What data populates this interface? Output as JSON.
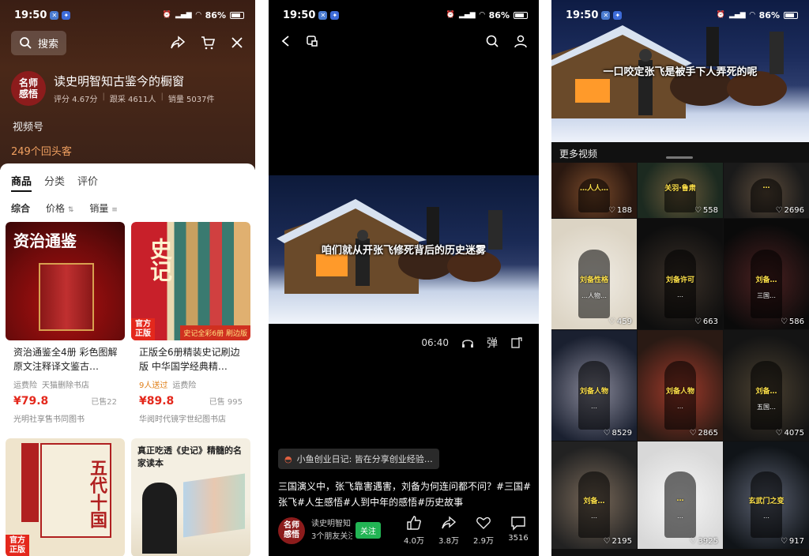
{
  "status": {
    "time": "19:50",
    "battery": "86%",
    "net_top": "427",
    "net_bottom": "B/s"
  },
  "shop_panel": {
    "search_label": "搜索",
    "shop_logo": "名师\n感悟",
    "shop_name": "读史明智知古鉴今的橱窗",
    "rating": "评分 4.67分",
    "reviews": "跟采 4611人",
    "sales": "销量 5037件",
    "channel": "视频号",
    "repeat_customers": "249个回头客",
    "tabs": [
      "商品",
      "分类",
      "评价"
    ],
    "sorts": [
      "综合",
      "价格",
      "销量"
    ],
    "products": [
      {
        "title": "资治通鉴全4册 彩色图解原文注释译文鉴古…",
        "tag1": "运费险",
        "tag2": "天猫删除书店",
        "price": "¥79.8",
        "sold": "已售22",
        "store": "光明社享售书同图书",
        "cover_text": "资治通鉴",
        "badge": ""
      },
      {
        "title": "正版全6册精装史记刷边版 中华国学经典精…",
        "tag1": "9人送过",
        "tag2": "运费险",
        "price": "¥89.8",
        "sold": "已售 995",
        "store": "华阅时代镜字世纪图书店",
        "cover_text": "史记",
        "badge": "官方\n正版",
        "promo": "史记全彩6册 刷边版"
      },
      {
        "title": "",
        "cover_text": "五代十国",
        "badge": "官方\n正版"
      },
      {
        "title": "",
        "cover_text": "真正吃透《史记》精髓的名家读本"
      }
    ]
  },
  "video_panel": {
    "subtitle": "咱们就从开张飞修死背后的历史迷雾",
    "duration": "06:40",
    "danmaku_label": "弹",
    "promo": "小鱼创业日记: 皆在分享创业经验…",
    "description": "三国演义中，张飞靠害遇害，刘备为何连问都不问？#三国#张飞#人生感悟#人到中年的感悟#历史故事",
    "author_logo": "名师\n感悟",
    "author_name": "读史明智知",
    "author_sub": "3个朋友关注",
    "follow_label": "关注",
    "likes": "4.0万",
    "shares": "3.8万",
    "favorites": "2.9万",
    "comments": "3516"
  },
  "more_panel": {
    "top_subtitle": "一口咬定张飞是被手下人弄死的呢",
    "more_label": "更多视频",
    "videos": [
      {
        "cap": "…人人…",
        "count": "188"
      },
      {
        "cap": "关羽·鲁肃",
        "count": "558"
      },
      {
        "cap": "…",
        "count": "2696"
      },
      {
        "cap": "刘备性格",
        "sub": "…人物…",
        "count": "459"
      },
      {
        "cap": "刘备许可",
        "sub": "…",
        "count": "663"
      },
      {
        "cap": "刘备…",
        "sub": "三国…",
        "count": "586"
      },
      {
        "cap": "刘备人物",
        "sub": "…",
        "count": "8529"
      },
      {
        "cap": "刘备人物",
        "sub": "…",
        "count": "2865"
      },
      {
        "cap": "刘备…",
        "sub": "五国…",
        "count": "4075"
      },
      {
        "cap": "刘备…",
        "sub": "…",
        "count": "2195"
      },
      {
        "cap": "…",
        "sub": "…",
        "count": "3925"
      },
      {
        "cap": "玄武门之变",
        "sub": "…",
        "count": "917"
      }
    ]
  }
}
